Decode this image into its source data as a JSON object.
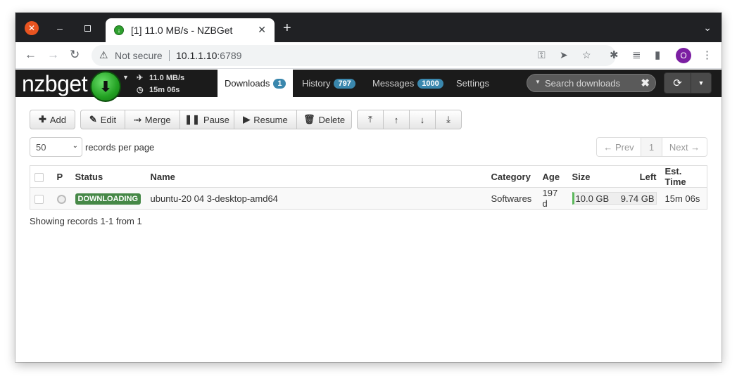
{
  "browser": {
    "tab_title": "[1] 11.0 MB/s - NZBGet",
    "security_label": "Not secure",
    "url_host": "10.1.1.10",
    "url_port": ":6789",
    "profile_initial": "O"
  },
  "app": {
    "logo": "nzbget",
    "speed": "11.0 MB/s",
    "time_left": "15m 06s",
    "tabs": [
      {
        "label": "Downloads",
        "badge": "1"
      },
      {
        "label": "History",
        "badge": "797"
      },
      {
        "label": "Messages",
        "badge": "1000"
      },
      {
        "label": "Settings"
      }
    ],
    "search_placeholder": "Search downloads",
    "accent_color": "#3a87ad",
    "status_color": "#468847"
  },
  "toolbar": {
    "add": "Add",
    "edit": "Edit",
    "merge": "Merge",
    "pause": "Pause",
    "resume": "Resume",
    "delete": "Delete"
  },
  "paging": {
    "page_size": "50",
    "records_label": "records per page",
    "prev": "← Prev",
    "page": "1",
    "next": "Next →"
  },
  "table": {
    "headers": {
      "p": "P",
      "status": "Status",
      "name": "Name",
      "category": "Category",
      "age": "Age",
      "size": "Size",
      "left": "Left",
      "est_time": "Est. Time"
    },
    "rows": [
      {
        "status": "DOWNLOADING",
        "name": "ubuntu-20 04 3-desktop-amd64",
        "category": "Softwares",
        "age": "197 d",
        "size": "10.0 GB",
        "left": "9.74 GB",
        "est_time": "15m 06s"
      }
    ]
  },
  "footer": {
    "showing": "Showing records 1-1 from 1"
  }
}
